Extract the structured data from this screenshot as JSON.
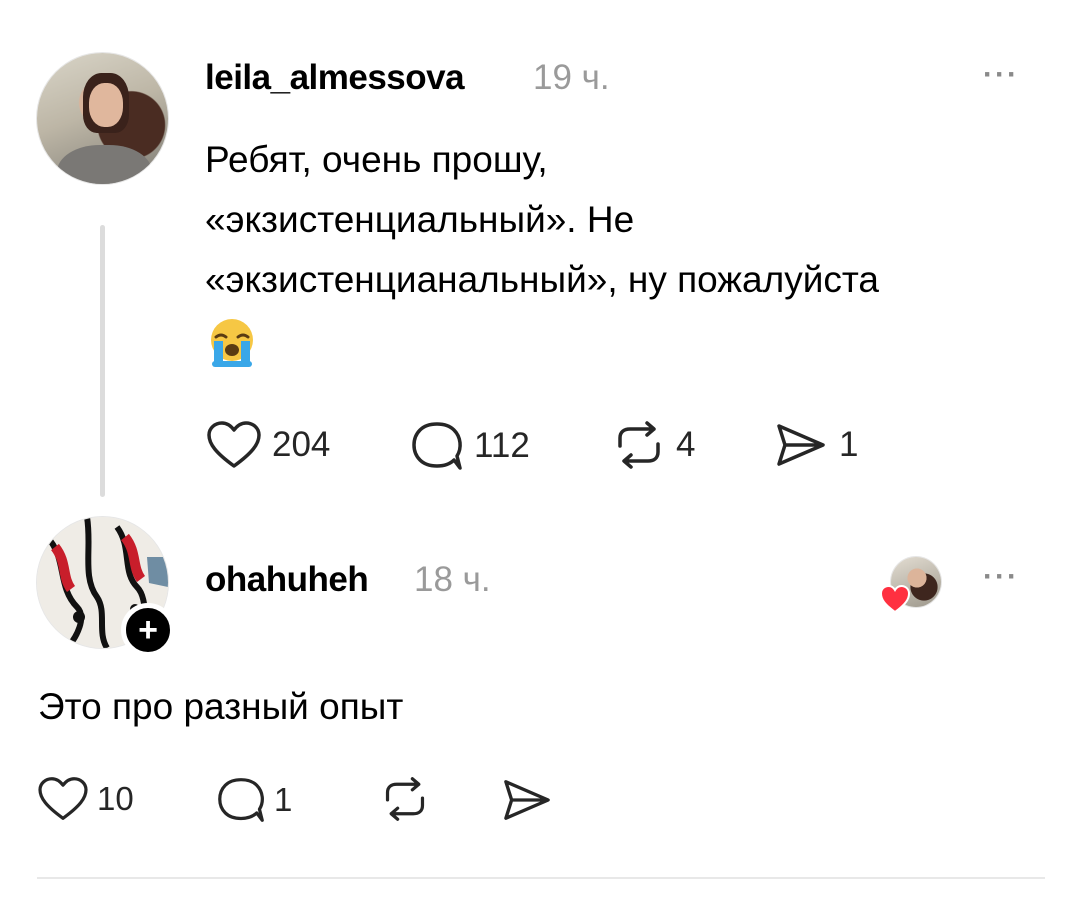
{
  "post": {
    "username": "leila_almessova",
    "time": "19 ч.",
    "more": "···",
    "text_lines": [
      "Ребят, очень прошу,",
      "«экзистенциальный». Не",
      "«экзистенцианальный», ну пожалуйста"
    ],
    "emoji": "crying-face",
    "likes": "204",
    "replies": "112",
    "reposts": "4",
    "shares": "1"
  },
  "reply": {
    "username": "ohahuheh",
    "time": "18 ч.",
    "more": "···",
    "follow_symbol": "+",
    "text": "Это про разный опыт",
    "likes": "10",
    "replies": "1"
  },
  "colors": {
    "text": "#000000",
    "muted": "#9a9a9a",
    "heart": "#ff3040",
    "divider": "#e8e8e8"
  }
}
